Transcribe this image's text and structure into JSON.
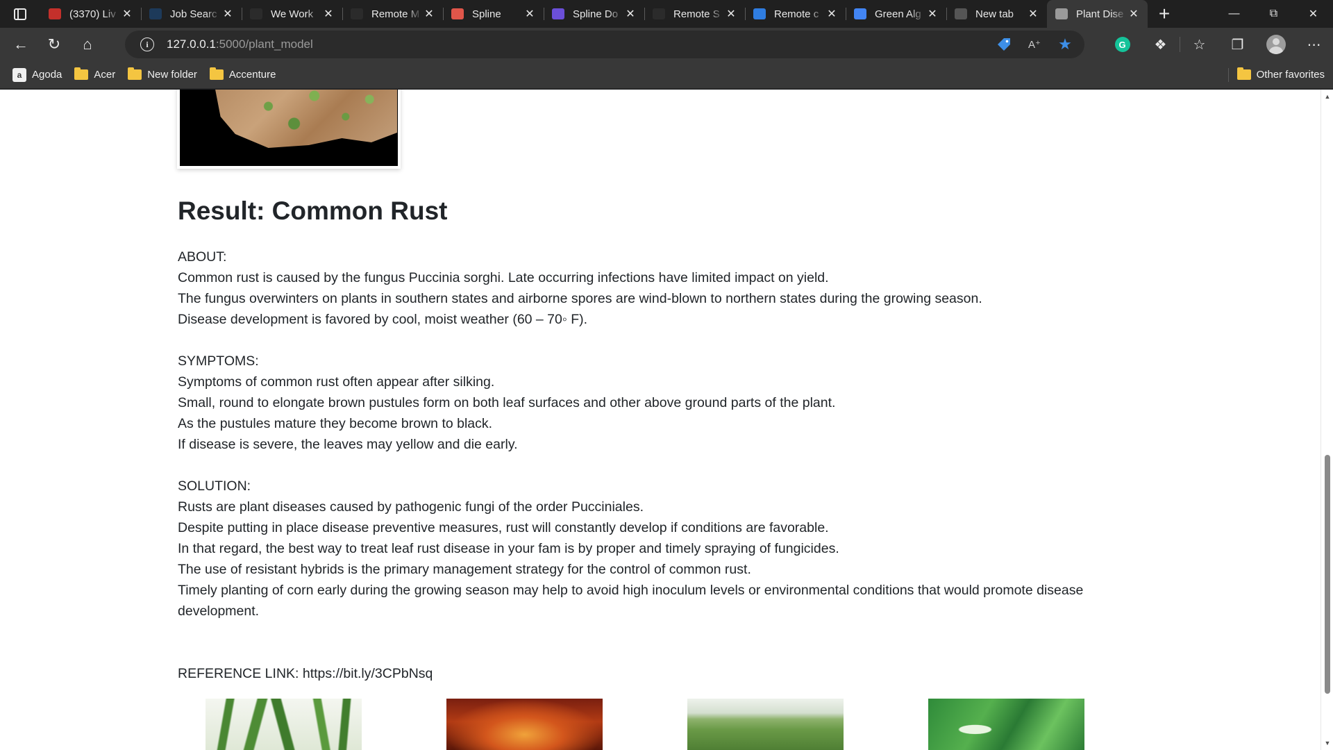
{
  "browser": {
    "tabs": [
      {
        "title": "(3370) Liv",
        "favicon": "youtube-icon",
        "color": "#c4302b"
      },
      {
        "title": "Job Searc",
        "favicon": "job-search-icon",
        "color": "#1d3a5a"
      },
      {
        "title": "We Work",
        "favicon": "wwr-icon",
        "color": "#2b2b2b"
      },
      {
        "title": "Remote M",
        "favicon": "wwr-icon",
        "color": "#2b2b2b"
      },
      {
        "title": "Spline",
        "favicon": "spline-icon",
        "color": "#e0564a"
      },
      {
        "title": "Spline Do",
        "favicon": "spline-doc-icon",
        "color": "#6b4fd8"
      },
      {
        "title": "Remote S",
        "favicon": "wwr-icon",
        "color": "#2b2b2b"
      },
      {
        "title": "Remote c",
        "favicon": "remote-co-icon",
        "color": "#2f7de1"
      },
      {
        "title": "Green Alg",
        "favicon": "google-search-icon",
        "color": "#4285f4"
      },
      {
        "title": "New tab",
        "favicon": "new-tab-icon",
        "color": "#555555"
      },
      {
        "title": "Plant Dise",
        "favicon": "page-icon",
        "color": "#9a9a9a",
        "active": true
      }
    ],
    "url_host": "127.0.0.1",
    "url_rest": ":5000/plant_model",
    "favorites": [
      {
        "label": "Agoda",
        "icon": "agoda-icon"
      },
      {
        "label": "Acer",
        "icon": "folder-icon"
      },
      {
        "label": "New folder",
        "icon": "folder-icon"
      },
      {
        "label": "Accenture",
        "icon": "folder-icon"
      }
    ],
    "other_favorites": "Other favorites"
  },
  "page": {
    "result": "Result: Common Rust",
    "about": {
      "heading": "ABOUT:",
      "lines": [
        "Common rust is caused by the fungus Puccinia sorghi. Late occurring infections have limited impact on yield.",
        "The fungus overwinters on plants in southern states and airborne spores are wind-blown to northern states during the growing season.",
        "Disease development is favored by cool, moist weather (60 – 70◦ F)."
      ]
    },
    "symptoms": {
      "heading": "SYMPTOMS:",
      "lines": [
        "Symptoms of common rust often appear after silking.",
        "Small, round to elongate brown pustules form on both leaf surfaces and other above ground parts of the plant.",
        "As the pustules mature they become brown to black.",
        "If disease is severe, the leaves may yellow and die early."
      ]
    },
    "solution": {
      "heading": "SOLUTION:",
      "lines": [
        "Rusts are plant diseases caused by pathogenic fungi of the order Pucciniales.",
        "Despite putting in place disease preventive measures, rust will constantly develop if conditions are favorable.",
        "In that regard, the best way to treat leaf rust disease in your fam is by proper and timely spraying of fungicides.",
        "The use of resistant hybrids is the primary management strategy for the control of common rust.",
        "Timely planting of corn early during the growing season may help to avoid high inoculum levels or environmental conditions that would promote disease development."
      ]
    },
    "reference": "REFERENCE LINK: https://bit.ly/3CPbNsq"
  }
}
